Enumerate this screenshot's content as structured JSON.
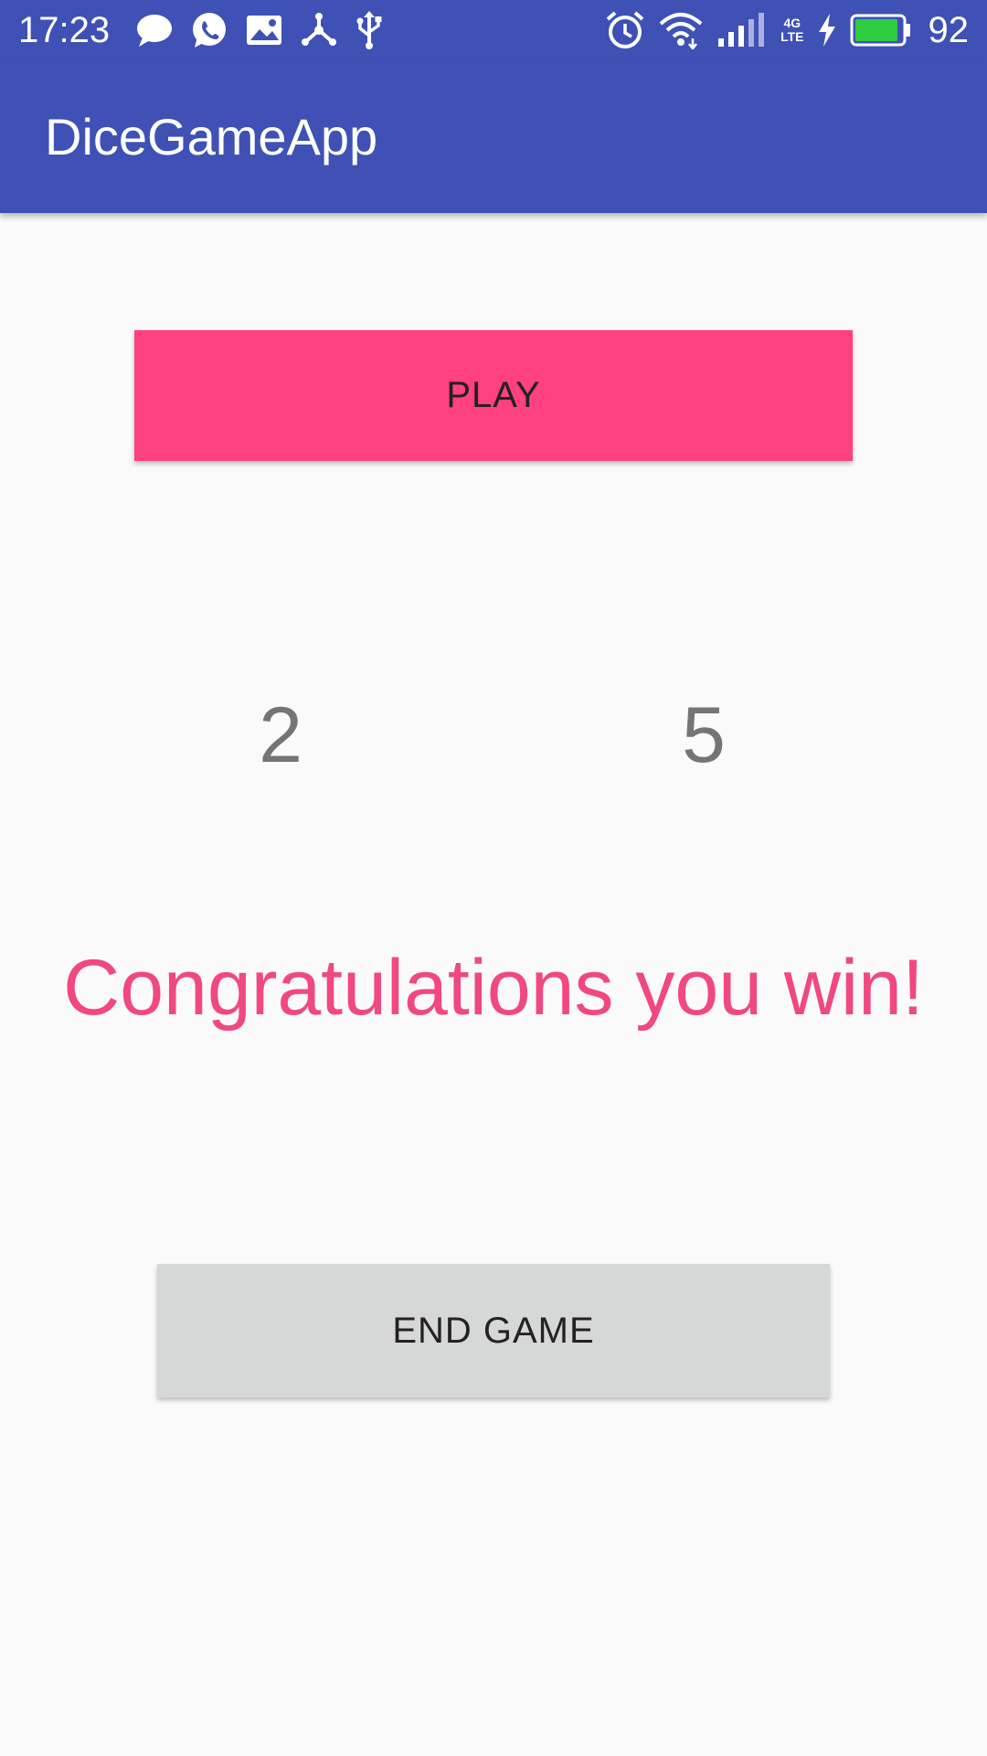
{
  "status_bar": {
    "time": "17:23",
    "battery_percent": "92",
    "network_label_top": "4G",
    "network_label_bottom": "LTE",
    "left_icons": [
      "chat-bubble-icon",
      "whatsapp-icon",
      "image-icon",
      "share-hub-icon",
      "usb-icon"
    ],
    "right_icons": [
      "alarm-icon",
      "wifi-icon",
      "signal-icon",
      "charging-bolt-icon",
      "battery-icon"
    ],
    "background_color": "#3f51b5",
    "battery_fill_color": "#2ecc40"
  },
  "app_bar": {
    "title": "DiceGameApp"
  },
  "main": {
    "play_label": "PLAY",
    "die_left": "2",
    "die_right": "5",
    "result_message": "Congratulations you win!",
    "end_label": "END GAME"
  },
  "colors": {
    "primary": "#3f51b5",
    "accent": "#ff4081",
    "message": "#f0487f",
    "secondary_button": "#d6d7d7",
    "die_text": "#757575"
  }
}
